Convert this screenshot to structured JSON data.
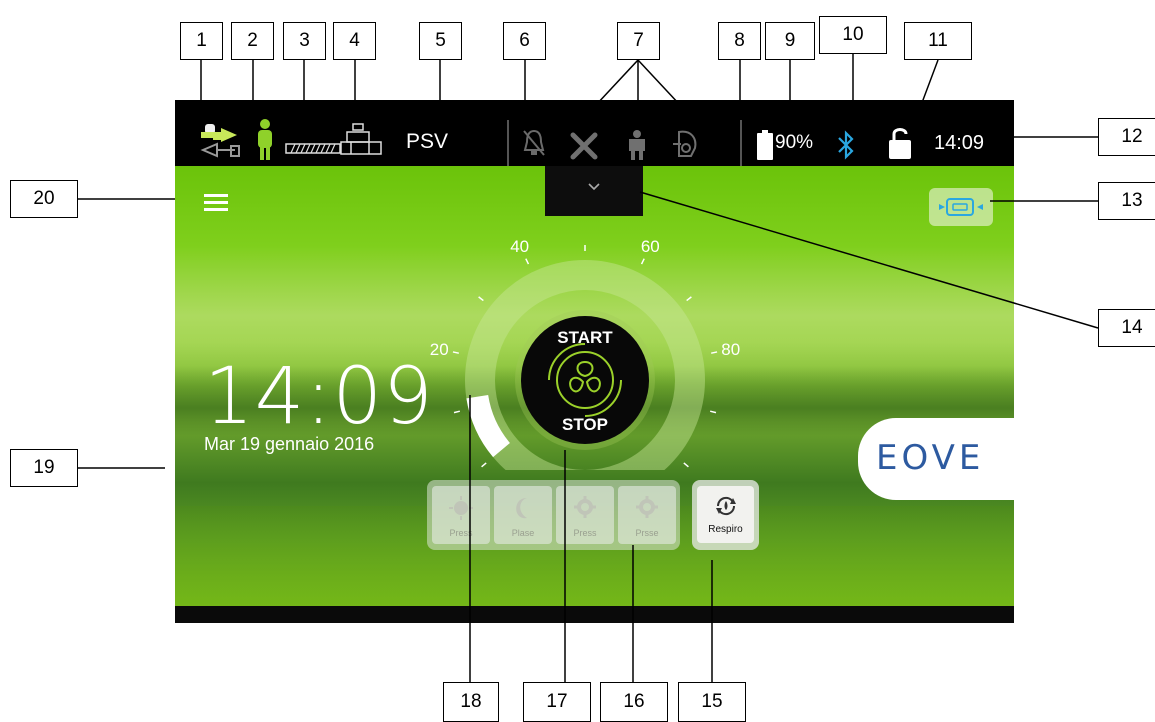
{
  "callouts": [
    "1",
    "2",
    "3",
    "4",
    "5",
    "6",
    "7",
    "8",
    "9",
    "10",
    "11",
    "12",
    "13",
    "14",
    "15",
    "16",
    "17",
    "18",
    "19",
    "20"
  ],
  "status_bar": {
    "mode": "PSV",
    "battery": "90%",
    "time": "14:09",
    "icons": [
      "circuit-connection-icon",
      "patient-icon",
      "circuit-hose-icon",
      "valve-icon",
      "alarm-muted-icon",
      "tools-icon",
      "patient-type-icon",
      "mask-icon",
      "battery-icon",
      "bluetooth-icon",
      "unlock-icon"
    ]
  },
  "clock": {
    "time": "14:09",
    "date": "Mar 19 gennaio 2016"
  },
  "gauge": {
    "ticks": [
      "0",
      "20",
      "40",
      "60",
      "80",
      "100"
    ],
    "value_fraction": 0.12,
    "start_label": "START",
    "stop_label": "STOP"
  },
  "modes": [
    {
      "label": "Press",
      "icon": "sun-icon"
    },
    {
      "label": "Plase",
      "icon": "moon-icon"
    },
    {
      "label": "Press",
      "icon": "gear-icon"
    },
    {
      "label": "Prsse",
      "icon": "gear-icon"
    }
  ],
  "respiro": {
    "label": "Respiro"
  },
  "brand": "EOVE",
  "colors": {
    "background_green": "#6bc30a",
    "accent_blue": "#2aa7e0",
    "status_bar": "#000000"
  }
}
